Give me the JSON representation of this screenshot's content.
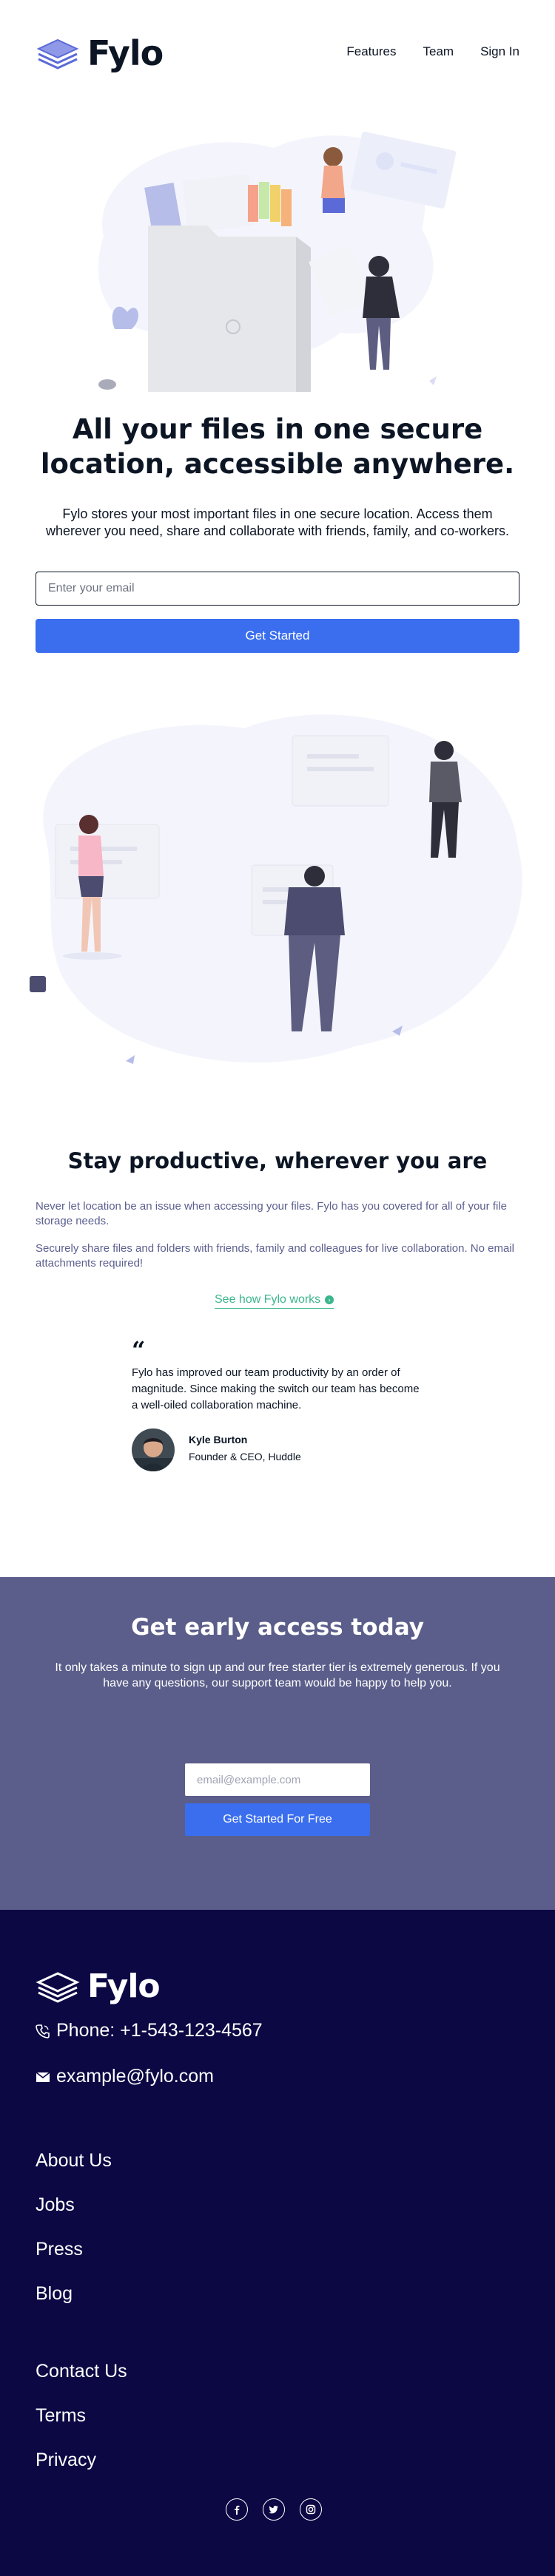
{
  "header": {
    "brand": "Fylo",
    "nav": [
      "Features",
      "Team",
      "Sign In"
    ]
  },
  "hero": {
    "title": "All your files in one secure location, accessible anywhere.",
    "description": "Fylo stores your most important files in one secure location. Access them wherever you need, share and collaborate with friends, family, and co-workers.",
    "email_placeholder": "Enter your email",
    "cta": "Get Started"
  },
  "productive": {
    "title": "Stay productive, wherever you are",
    "paragraphs": [
      "Never let location be an issue when accessing your files. Fylo has you covered for all of your file storage needs.",
      "Securely share files and folders with friends, family and colleagues for live collaboration. No email attachments required!"
    ],
    "link": "See how Fylo works"
  },
  "testimonial": {
    "quote_mark": "“",
    "quote": "Fylo has improved our team productivity by an order of magnitude. Since making the switch our team has become a well-oiled collaboration machine.",
    "name": "Kyle Burton",
    "role": "Founder & CEO, Huddle"
  },
  "early_access": {
    "title": "Get early access today",
    "description": "It only takes a minute to sign up and our free starter tier is extremely generous. If you have any questions, our support team would be happy to help you.",
    "email_placeholder": "email@example.com",
    "cta": "Get Started For Free"
  },
  "footer": {
    "brand": "Fylo",
    "phone": "Phone: +1-543-123-4567",
    "email": "example@fylo.com",
    "links_group_1": [
      "About Us",
      "Jobs",
      "Press",
      "Blog"
    ],
    "links_group_2": [
      "Contact Us",
      "Terms",
      "Privacy"
    ],
    "socials": [
      "facebook-icon",
      "twitter-icon",
      "instagram-icon"
    ]
  },
  "colors": {
    "accent_blue": "#3a6eef",
    "link_green": "#3bb58d",
    "early_access_bg": "#5b5e8a",
    "footer_bg": "#0c0844",
    "text_dark": "#0c1524",
    "muted_text": "#5b5f8e"
  }
}
